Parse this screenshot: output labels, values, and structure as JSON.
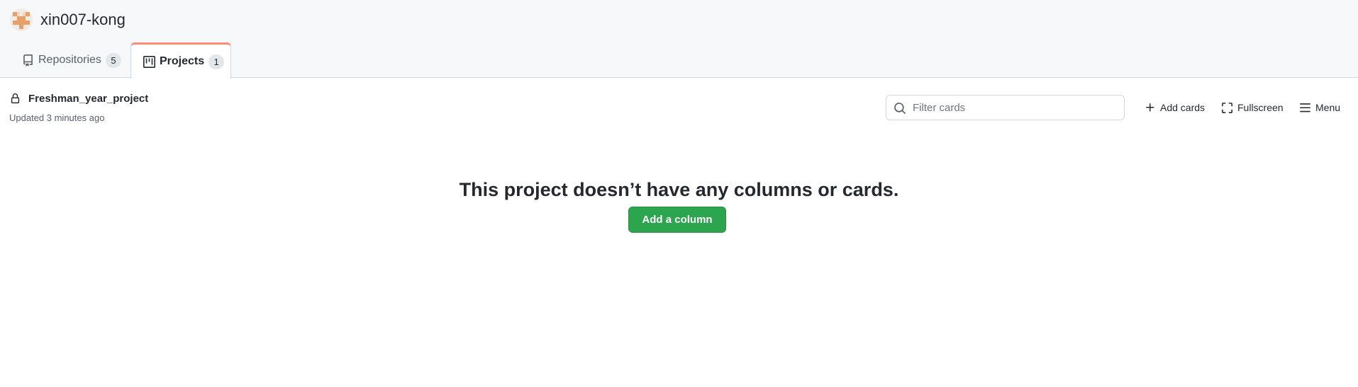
{
  "owner": {
    "name": "xin007-kong",
    "avatar_colors": [
      "#e8a06b",
      "#f3ece6"
    ]
  },
  "tabs": [
    {
      "label": "Repositories",
      "count": "5",
      "icon": "repo-icon",
      "selected": false
    },
    {
      "label": "Projects",
      "count": "1",
      "icon": "project-icon",
      "selected": true
    }
  ],
  "project": {
    "title": "Freshman_year_project",
    "updated": "Updated 3 minutes ago",
    "visibility_icon": "lock-icon"
  },
  "toolbar": {
    "filter_placeholder": "Filter cards",
    "filter_value": "",
    "add_cards_label": "Add cards",
    "fullscreen_label": "Fullscreen",
    "menu_label": "Menu"
  },
  "empty_state": {
    "message": "This project doesn’t have any columns or cards.",
    "button_label": "Add a column"
  },
  "colors": {
    "accent_tab": "#fd8c73",
    "primary_button": "#2da44e",
    "header_bg": "#f6f8fa"
  }
}
